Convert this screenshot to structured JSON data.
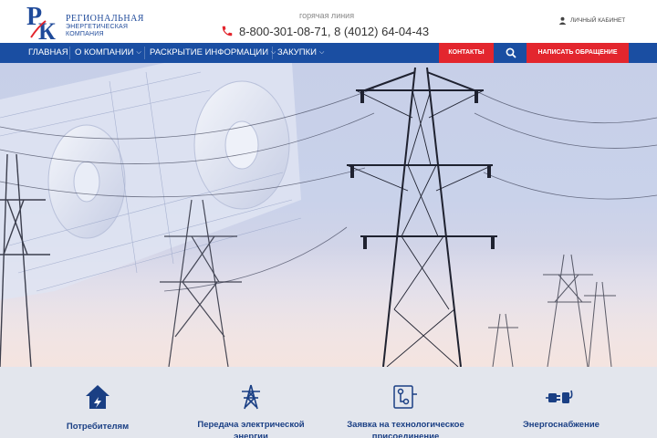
{
  "logo": {
    "line1": "Региональная",
    "line2": "энергетическая",
    "line3": "компания"
  },
  "header": {
    "hotline_label": "горячая линия",
    "phone": "8-800-301-08-71, 8 (4012) 64-04-43",
    "cabinet_label": "Личный кабинет"
  },
  "nav": {
    "items": [
      {
        "label": "Главная"
      },
      {
        "label": "О компании"
      },
      {
        "label": "Раскрытие информации"
      },
      {
        "label": "Закупки"
      }
    ],
    "contacts_label": "Контакты",
    "write_label": "Написать обращение"
  },
  "services": [
    {
      "label": "Потребителям",
      "icon": "house-energy-icon"
    },
    {
      "label": "Передача электрической энергии",
      "icon": "power-tower-icon"
    },
    {
      "label": "Заявка на технологическое присоединение",
      "icon": "connection-scheme-icon"
    },
    {
      "label": "Энергоснабжение",
      "icon": "plug-icon"
    }
  ],
  "colors": {
    "brand_blue": "#1a4ea2",
    "accent_red": "#e3262e",
    "service_text": "#1a3f84"
  }
}
